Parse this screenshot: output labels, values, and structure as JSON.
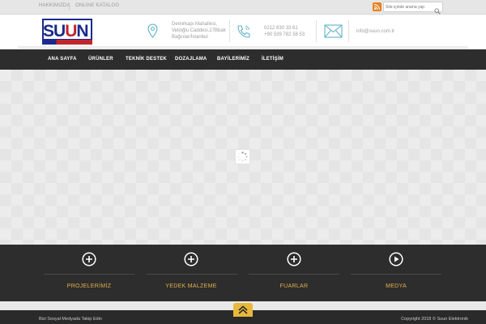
{
  "topbar": {
    "links": [
      "HAKKIMIZDA",
      "ONLINE KATALOG"
    ],
    "search_placeholder": "Site içinde arama yap"
  },
  "header": {
    "logo_text": "SUUN",
    "address_lines": [
      "Demirkapı Mahallesi,",
      "Velioğlu Caddesi.27Bbak",
      "Bağcılar/İstanbul"
    ],
    "phones": [
      "0212 630 33 61",
      "+90 539 782 58 53"
    ],
    "email": "info@suun.com.tr"
  },
  "nav": {
    "items": [
      "ANA SAYFA",
      "ÜRÜNLER",
      "TEKNİK DESTEK",
      "DOZAJLAMA",
      "BAYİLERİMİZ",
      "İLETİŞİM"
    ]
  },
  "features": [
    {
      "label": "PROJELERİMİZ",
      "icon": "plus-circle-icon"
    },
    {
      "label": "YEDEK MALZEME",
      "icon": "plus-circle-icon"
    },
    {
      "label": "FUARLAR",
      "icon": "plus-circle-icon"
    },
    {
      "label": "MEDYA",
      "icon": "play-circle-icon"
    }
  ],
  "footer": {
    "social_text": "Bizi Sosyal Medyada Takip Edin",
    "copyright": "Copyright 2018 © Suun Elektronik"
  },
  "colors": {
    "nav_bg": "#2d2d2d",
    "accent_gold": "#e3b04b",
    "logo_blue": "#1a2a8c",
    "logo_red": "#c0262d",
    "rss_orange": "#e8801c"
  }
}
